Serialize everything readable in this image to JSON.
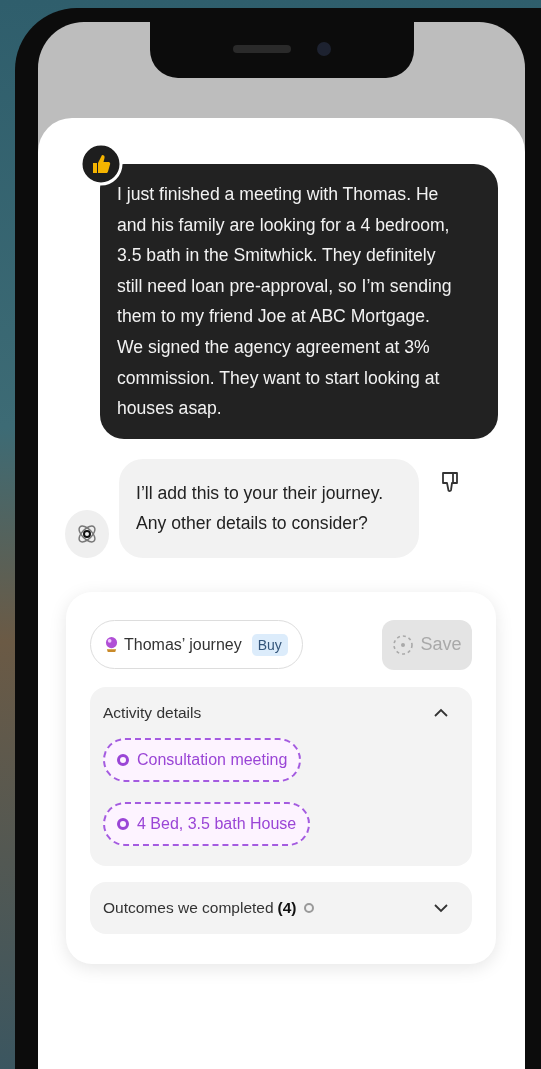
{
  "user_message": {
    "text": "I just finished a meeting with Thomas. He and his family are looking for a 4 bedroom, 3.5 bath in the Smitwhick. They definitely still need loan pre-approval, so I’m sending them to my friend Joe at ABC Mortgage. We signed the agency agreement at 3% commission. They want to start looking at houses asap."
  },
  "assistant_message": {
    "text": "I’ll add this to your their journey. Any other details to consider?"
  },
  "journey": {
    "name": "Thomas’ journey",
    "tag": "Buy"
  },
  "save_button": {
    "label": "Save",
    "disabled": true
  },
  "sections": [
    {
      "title": "Activity details",
      "expanded": true,
      "chips": [
        "Consultation meeting",
        "4 Bed, 3.5 bath House"
      ]
    },
    {
      "title": "Outcomes we completed",
      "count": "(4)",
      "expanded": false
    }
  ]
}
